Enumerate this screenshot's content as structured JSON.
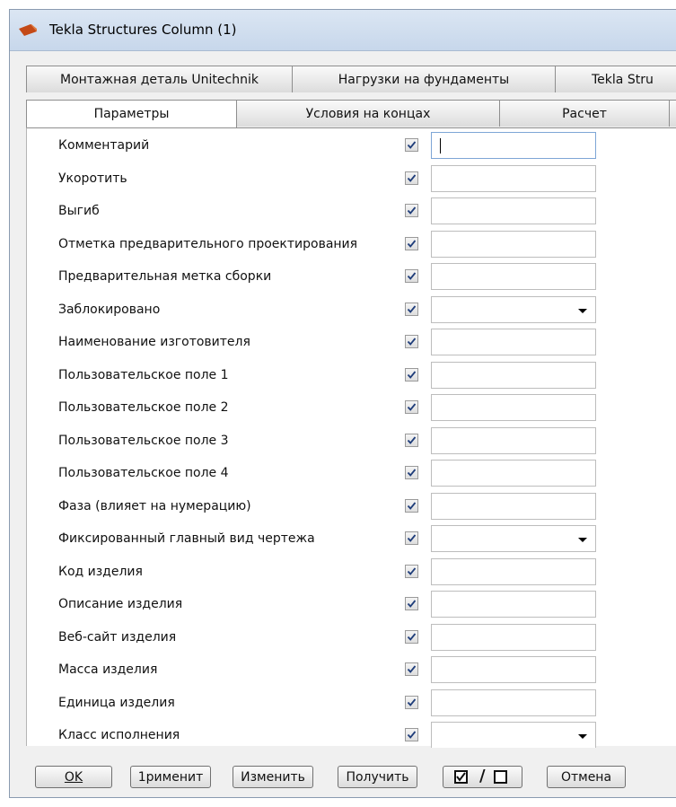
{
  "window": {
    "title": "Tekla Structures  Column (1)",
    "accent": "#c9d9ee"
  },
  "tabs_back": [
    "Монтажная деталь Unitechnik",
    "Нагрузки на фундаменты",
    "Tekla Stru"
  ],
  "tabs_front": [
    "Параметры",
    "Условия на концах",
    "Расчет"
  ],
  "active_tab": "Параметры",
  "fields": [
    {
      "label": "Комментарий",
      "checked": true,
      "type": "text",
      "value": ""
    },
    {
      "label": "Укоротить",
      "checked": true,
      "type": "text",
      "value": ""
    },
    {
      "label": "Выгиб",
      "checked": true,
      "type": "text",
      "value": ""
    },
    {
      "label": "Отметка предварительного проектирования",
      "checked": true,
      "type": "text",
      "value": ""
    },
    {
      "label": "Предварительная метка сборки",
      "checked": true,
      "type": "text",
      "value": ""
    },
    {
      "label": "Заблокировано",
      "checked": true,
      "type": "dropdown",
      "value": ""
    },
    {
      "label": "Наименование изготовителя",
      "checked": true,
      "type": "text",
      "value": ""
    },
    {
      "label": "Пользовательское поле 1",
      "checked": true,
      "type": "text",
      "value": ""
    },
    {
      "label": "Пользовательское поле 2",
      "checked": true,
      "type": "text",
      "value": ""
    },
    {
      "label": "Пользовательское поле 3",
      "checked": true,
      "type": "text",
      "value": ""
    },
    {
      "label": "Пользовательское поле 4",
      "checked": true,
      "type": "text",
      "value": ""
    },
    {
      "label": "Фаза  (влияет на нумерацию)",
      "checked": true,
      "type": "text",
      "value": ""
    },
    {
      "label": "Фиксированный главный вид чертежа",
      "checked": true,
      "type": "dropdown",
      "value": ""
    },
    {
      "label": "Код изделия",
      "checked": true,
      "type": "text",
      "value": ""
    },
    {
      "label": "Описание изделия",
      "checked": true,
      "type": "text",
      "value": ""
    },
    {
      "label": "Веб-сайт изделия",
      "checked": true,
      "type": "text",
      "value": ""
    },
    {
      "label": "Масса изделия",
      "checked": true,
      "type": "text",
      "value": ""
    },
    {
      "label": "Единица изделия",
      "checked": true,
      "type": "text",
      "value": ""
    },
    {
      "label": "Класс исполнения",
      "checked": true,
      "type": "dropdown",
      "value": ""
    }
  ],
  "buttons": {
    "ok": "OK",
    "apply": "1рименит",
    "modify": "Изменить",
    "get": "Получить",
    "cancel": "Отмена"
  }
}
